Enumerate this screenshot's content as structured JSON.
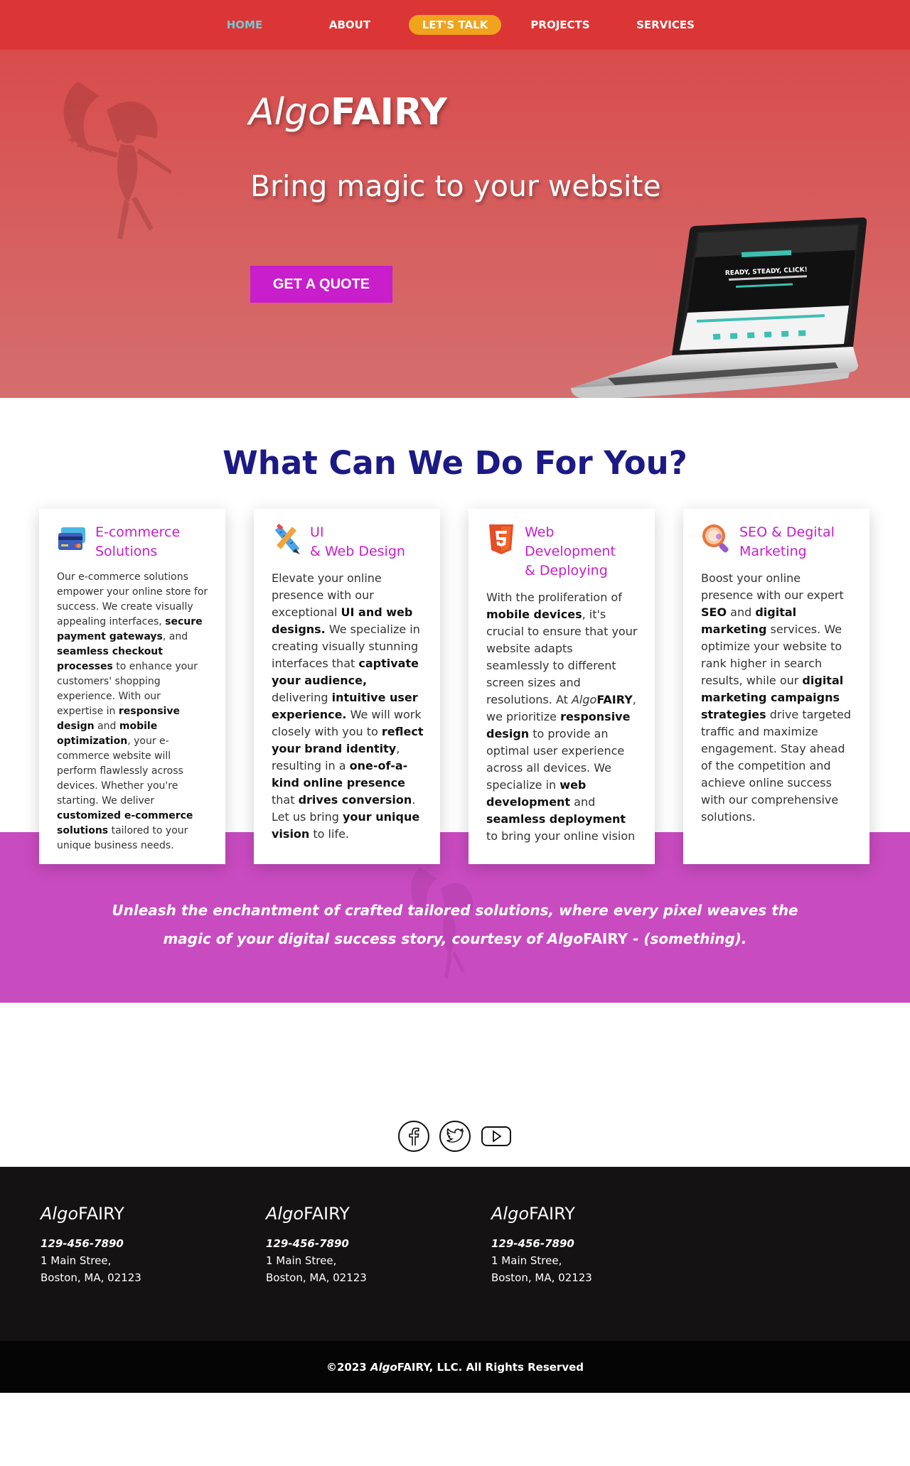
{
  "nav": {
    "items": [
      {
        "label": "HOME",
        "active": true
      },
      {
        "label": "ABOUT"
      },
      {
        "label": "LET'S TALK",
        "pill": true
      },
      {
        "label": "PROJECTS"
      },
      {
        "label": "SERVICES"
      }
    ]
  },
  "hero": {
    "brand_algo": "Algo",
    "brand_fairy": "FAIRY",
    "tagline": "Bring magic to your website",
    "cta_label": "GET A QUOTE"
  },
  "services": {
    "title": "What Can We Do For You?",
    "cards": [
      {
        "title_line1": "E-commerce",
        "title_line2": "Solutions",
        "icon": "credit-card-icon",
        "body": [
          {
            "t": "Our e-commerce solutions empower your online store for success. We create visually appealing interfaces, "
          },
          {
            "t": "secure payment gateways",
            "b": true
          },
          {
            "t": ", and "
          },
          {
            "t": "seamless checkout processes",
            "b": true
          },
          {
            "t": " to enhance your customers' shopping experience. With our expertise in "
          },
          {
            "t": "responsive design",
            "b": true
          },
          {
            "t": " and "
          },
          {
            "t": "mobile optimization",
            "b": true
          },
          {
            "t": ", your e-commerce website will perform flawlessly across devices. Whether you're starting. We deliver "
          },
          {
            "t": "customized e-commerce solutions",
            "b": true
          },
          {
            "t": " tailored to your unique business needs."
          }
        ]
      },
      {
        "title_line1": "UI",
        "title_line2": "& Web Design",
        "icon": "ruler-pencil-icon",
        "body": [
          {
            "t": "Elevate your online presence with our exceptional "
          },
          {
            "t": "UI and web designs.",
            "b": true
          },
          {
            "t": " We specialize in creating visually stunning interfaces that "
          },
          {
            "t": "captivate your audience,",
            "b": true
          },
          {
            "t": " delivering "
          },
          {
            "t": "intuitive user experience.",
            "b": true
          },
          {
            "t": " We will work closely with you to "
          },
          {
            "t": "reflect your brand identity",
            "b": true
          },
          {
            "t": ", resulting in a "
          },
          {
            "t": "one-of-a-kind online presence",
            "b": true
          },
          {
            "t": " that "
          },
          {
            "t": "drives conversion",
            "b": true
          },
          {
            "t": ". Let us bring "
          },
          {
            "t": "your unique vision",
            "b": true
          },
          {
            "t": " to life."
          }
        ]
      },
      {
        "title_line1": "Web Development",
        "title_line2": "& Deploying",
        "icon": "html5-icon",
        "body": [
          {
            "t": "With the proliferation of "
          },
          {
            "t": "mobile devices",
            "b": true
          },
          {
            "t": ", it's crucial to ensure that your website adapts seamlessly to different screen sizes and resolutions. At "
          },
          {
            "t": "Algo",
            "i": true
          },
          {
            "t": "FAIRY",
            "b": true
          },
          {
            "t": ", we prioritize "
          },
          {
            "t": "responsive design",
            "b": true
          },
          {
            "t": " to provide an optimal user experience across all devices. We specialize in "
          },
          {
            "t": "web development",
            "b": true
          },
          {
            "t": " and "
          },
          {
            "t": "seamless deployment",
            "b": true
          },
          {
            "t": " to bring your online vision"
          }
        ]
      },
      {
        "title_line1": "SEO & Degital",
        "title_line2": "Marketing",
        "icon": "magnifier-icon",
        "body": [
          {
            "t": "Boost your online presence with our expert "
          },
          {
            "t": "SEO",
            "b": true
          },
          {
            "t": " and "
          },
          {
            "t": "digital marketing",
            "b": true
          },
          {
            "t": " services. We optimize your website to rank higher in search results, while our "
          },
          {
            "t": "digital marketing campaigns strategies",
            "b": true
          },
          {
            "t": " drive targeted traffic and maximize engagement. Stay ahead of the competition and achieve online success with our comprehensive solutions."
          }
        ]
      }
    ]
  },
  "band": {
    "text_before": "Unleash the enchantment of crafted tailored solutions, where every pixel weaves the magic of your digital success story, courtesy of Algo",
    "brand_fairy": "FAIRY",
    "text_after": " - (something)."
  },
  "social": {
    "icons": [
      "facebook-icon",
      "twitter-icon",
      "youtube-icon"
    ]
  },
  "footer": {
    "columns": [
      {
        "brand_algo": "Algo",
        "brand_fairy": "FAIRY",
        "phone": "129-456-7890",
        "address1": "1 Main Stree,",
        "address2": "Boston, MA, 02123"
      },
      {
        "brand_algo": "Algo",
        "brand_fairy": "FAIRY",
        "phone": "129-456-7890",
        "address1": "1 Main Stree,",
        "address2": "Boston, MA, 02123"
      },
      {
        "brand_algo": "Algo",
        "brand_fairy": "FAIRY",
        "phone": "129-456-7890",
        "address1": "1 Main Stree,",
        "address2": "Boston, MA, 02123"
      }
    ],
    "copyright_prefix": "©2023 ",
    "copyright_algo": "Algo",
    "copyright_suffix": "FAIRY, LLC. All Rights Reserved"
  },
  "colors": {
    "nav_bg": "#db3535",
    "hero_bg": "#d65a5a",
    "accent_magenta": "#c81ecb",
    "title_navy": "#1c1a85",
    "pill_orange": "#f0a31c",
    "band_magenta": "#c94bc0",
    "footer_bg": "#141213"
  }
}
